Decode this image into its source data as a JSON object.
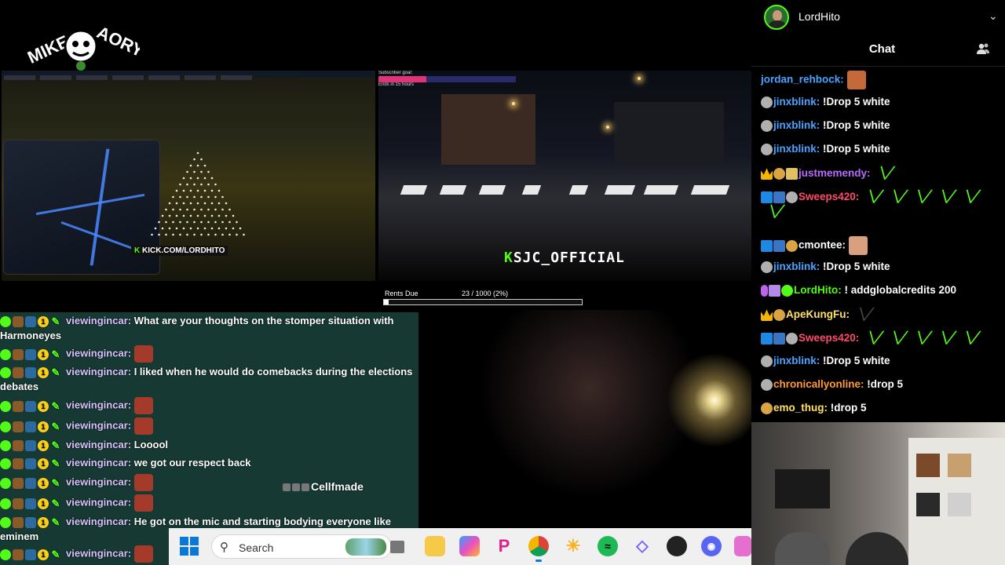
{
  "overlay": {
    "left_cam_handle": "KICK.COM/LORDHITO",
    "right_cam_handle": "SJC_OFFICIAL",
    "subscriber_goal_label": "Subscriber goal:",
    "subscriber_goal_ends": "Ends in 15 hours",
    "subscriber_goal_progress": 0.35,
    "rent_label": "Rents Due",
    "rent_value": "23 / 1000 (2%)",
    "rent_progress": 0.023,
    "cellf_tag": "Cellfmade"
  },
  "overlay_chat": [
    {
      "user": "viewingincar:",
      "text": "What are your thoughts on the stomper situation with Harmoneyes",
      "emote": false
    },
    {
      "user": "viewingincar:",
      "text": "",
      "emote": true
    },
    {
      "user": "viewingincar:",
      "text": "I liked when he would do comebacks during the elections debates",
      "emote": false
    },
    {
      "user": "viewingincar:",
      "text": "",
      "emote": true
    },
    {
      "user": "viewingincar:",
      "text": "",
      "emote": true
    },
    {
      "user": "viewingincar:",
      "text": "Looool",
      "emote": false
    },
    {
      "user": "viewingincar:",
      "text": "we got our respect back",
      "emote": false
    },
    {
      "user": "viewingincar:",
      "text": "",
      "emote": true
    },
    {
      "user": "viewingincar:",
      "text": "",
      "emote": true
    },
    {
      "user": "viewingincar:",
      "text": "He got on the mic and starting bodying everyone like eminem",
      "emote": false
    },
    {
      "user": "viewingincar:",
      "text": "",
      "emote": true
    }
  ],
  "taskbar": {
    "search_placeholder": "Search",
    "apps": [
      "file-explorer",
      "copilot",
      "picsart",
      "chrome",
      "sunny",
      "spotify",
      "pen",
      "obs",
      "discord",
      "extra"
    ]
  },
  "profile": {
    "name": "LordHito"
  },
  "chat_panel": {
    "title": "Chat",
    "messages": [
      {
        "user": "jordan_rehbock:",
        "color": "#4aa3ff",
        "text": "",
        "badges": [],
        "face": true
      },
      {
        "user": "jinxblink:",
        "color": "#4aa3ff",
        "text": "!Drop 5 white",
        "badges": [
          "skull"
        ]
      },
      {
        "user": "jinxblink:",
        "color": "#4aa3ff",
        "text": "!Drop 5 white",
        "badges": [
          "skull"
        ]
      },
      {
        "user": "jinxblink:",
        "color": "#4aa3ff",
        "text": "!Drop 5 white",
        "badges": [
          "skull"
        ]
      },
      {
        "user": "justmemendy:",
        "color": "#b86bff",
        "text": "",
        "badges": [
          "crown",
          "cookie",
          "gift"
        ],
        "kemotes": 1
      },
      {
        "user": "Sweeps420:",
        "color": "#ff4a6a",
        "text": "",
        "badges": [
          "bolt",
          "gb",
          "skull"
        ],
        "kemotes": 6
      },
      {
        "user": "cmontee:",
        "color": "#ffffff",
        "text": "",
        "badges": [
          "bolt",
          "gb",
          "cookie"
        ],
        "face": true
      },
      {
        "user": "jinxblink:",
        "color": "#4aa3ff",
        "text": "!Drop 5 white",
        "badges": [
          "skull"
        ]
      },
      {
        "user": "LordHito:",
        "color": "#53fc18",
        "text": "! addglobalcredits 200",
        "badges": [
          "mic",
          "gift2",
          "check"
        ]
      },
      {
        "user": "ApeKungFu:",
        "color": "#ffe066",
        "text": "",
        "badges": [
          "crown",
          "cookie"
        ],
        "kemotes": 1
      },
      {
        "user": "Sweeps420:",
        "color": "#ff4a6a",
        "text": "",
        "badges": [
          "bolt",
          "gb",
          "skull"
        ],
        "kemotes": 5
      },
      {
        "user": "jinxblink:",
        "color": "#4aa3ff",
        "text": "!Drop 5 white",
        "badges": [
          "skull"
        ]
      },
      {
        "user": "chronicallyonline:",
        "color": "#ff9a3a",
        "text": "!drop 5",
        "badges": [
          "skull"
        ]
      },
      {
        "user": "emo_thug:",
        "color": "#ffe066",
        "text": "!drop 5",
        "badges": [
          "cookie"
        ]
      }
    ]
  },
  "colors": {
    "kick_green": "#53fc18",
    "overlay_chat_bg": "#1e5046",
    "taskbar_bg": "#f0f0f0"
  }
}
